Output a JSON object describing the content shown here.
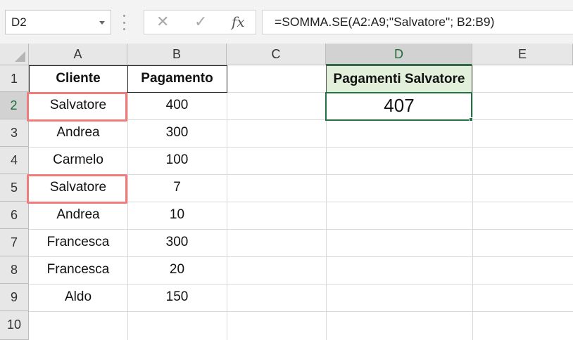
{
  "name_box": {
    "value": "D2"
  },
  "formula_bar": {
    "cancel_glyph": "✕",
    "enter_glyph": "✓",
    "fx_label": "fx",
    "formula": "=SOMMA.SE(A2:A9;\"Salvatore\"; B2:B9)"
  },
  "columns": [
    "A",
    "B",
    "C",
    "D",
    "E"
  ],
  "selected_column": "D",
  "rows": [
    "1",
    "2",
    "3",
    "4",
    "5",
    "6",
    "7",
    "8",
    "9",
    "10"
  ],
  "selected_row": "2",
  "table": {
    "headers": {
      "client": "Cliente",
      "payment": "Pagamento"
    },
    "records": [
      {
        "client": "Salvatore",
        "payment": "400"
      },
      {
        "client": "Andrea",
        "payment": "300"
      },
      {
        "client": "Carmelo",
        "payment": "100"
      },
      {
        "client": "Salvatore",
        "payment": "7"
      },
      {
        "client": "Andrea",
        "payment": "10"
      },
      {
        "client": "Francesca",
        "payment": "300"
      },
      {
        "client": "Francesca",
        "payment": "20"
      },
      {
        "client": "Aldo",
        "payment": "150"
      }
    ]
  },
  "result": {
    "label": "Pagamenti Salvatore",
    "value": "407"
  },
  "colors": {
    "accent_green": "#217346",
    "highlight_red": "#f07b7b",
    "header_fill": "#e2efda"
  }
}
